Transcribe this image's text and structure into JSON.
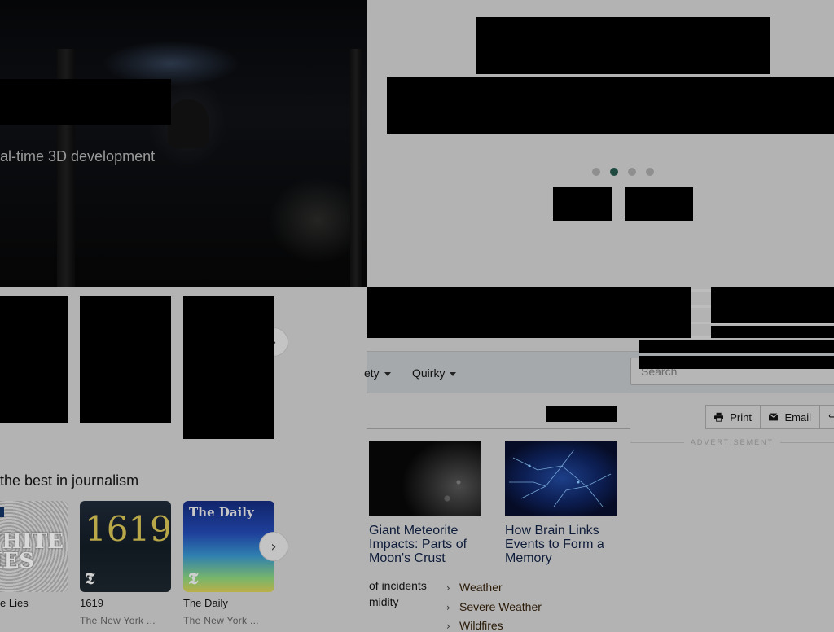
{
  "hero": {
    "subtitle": "al-time 3D development"
  },
  "slide": {
    "dots": 4,
    "active_dot": 2
  },
  "carousel": {
    "next_icon": "chevron-right-icon",
    "section_heading": "the best in journalism",
    "podcasts": [
      {
        "name": "e Lies",
        "sub": "",
        "tile_text": "WHITE LIES"
      },
      {
        "name": "1619",
        "sub": "The New York ...",
        "tile_text": "1619"
      },
      {
        "name": "The Daily",
        "sub": "The New York ...",
        "tile_text": "The Daily"
      }
    ]
  },
  "site": {
    "nav": [
      {
        "label": "ety"
      },
      {
        "label": "Quirky"
      }
    ],
    "search_placeholder": "Search",
    "share": [
      {
        "label": "Print",
        "icon": "print-icon"
      },
      {
        "label": "Email",
        "icon": "envelope-icon"
      }
    ],
    "ad_label": "ADVERTISEMENT",
    "articles": [
      {
        "title": "Giant Meteorite Impacts: Parts of Moon's Crust"
      },
      {
        "title": "How Brain Links Events to Form a Memory"
      }
    ],
    "left_list": [
      "of incidents",
      "midity"
    ],
    "links": [
      "Weather",
      "Severe Weather",
      "Wildfires"
    ]
  }
}
